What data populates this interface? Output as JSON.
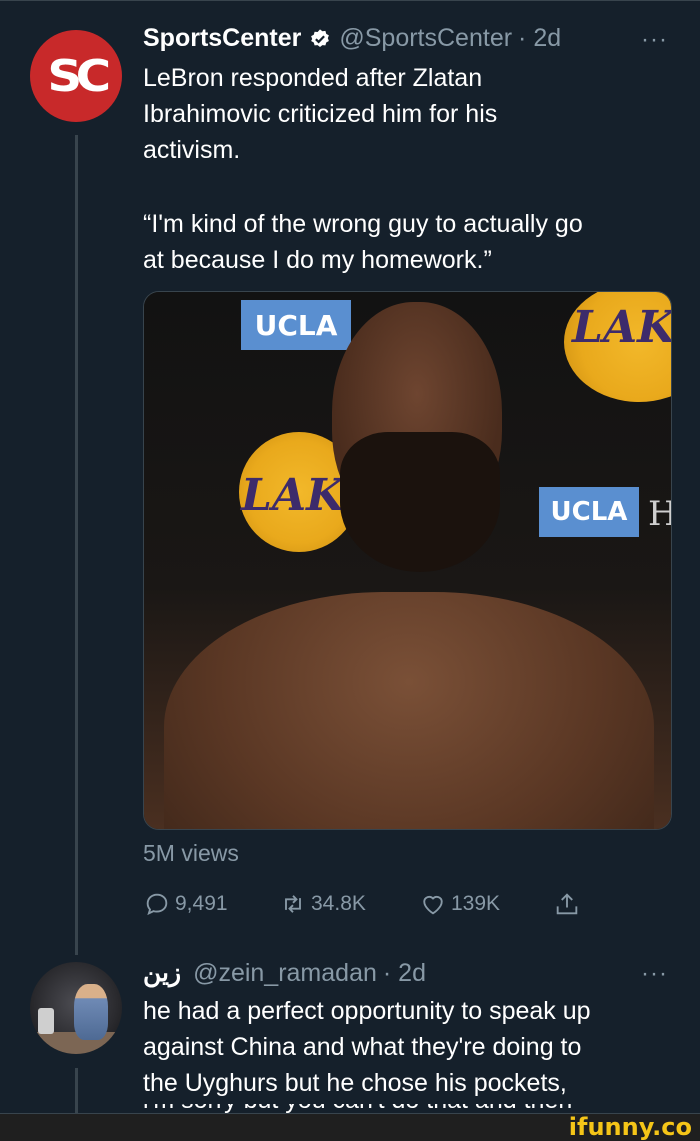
{
  "tweet1": {
    "display_name": "SportsCenter",
    "handle": "@SportsCenter",
    "time": "· 2d",
    "avatar_text": "SC",
    "text_lines": [
      "LeBron responded after Zlatan",
      "Ibrahimovic criticized him for his",
      "activism."
    ],
    "quote_lines": [
      "“I'm kind of the wrong guy to actually go",
      "at because I do my homework.”"
    ],
    "media": {
      "ucla_text": "UCLA",
      "lakers_text": "LAK",
      "edge_letter": "H"
    },
    "views": "5M views",
    "replies": "9,491",
    "retweets": "34.8K",
    "likes": "139K"
  },
  "tweet2": {
    "display_name": "زين",
    "handle": "@zein_ramadan",
    "time": "· 2d",
    "text_lines": [
      "he had a perfect opportunity to speak up",
      "against China and what they're doing to",
      "the Uyghurs but he chose his pockets,",
      "i'm sorry but you can't do that and then"
    ]
  },
  "more_label": "···",
  "watermark": "ifunny.co",
  "colors": {
    "background": "#15202b",
    "secondary_text": "#8899a6",
    "verified_blue": "#ffffff",
    "sportscenter_red": "#c8292a",
    "watermark_yellow": "#f5c518"
  }
}
